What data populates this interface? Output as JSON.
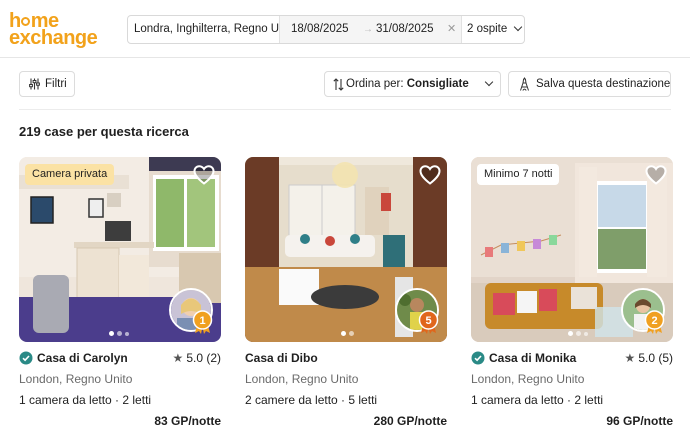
{
  "brand": {
    "line1": "h",
    "line1b": "me",
    "line2": "exchange"
  },
  "search": {
    "location": "Londra, Inghilterra, Regno Un",
    "date_start": "18/08/2025",
    "date_arrow": "→",
    "date_end": "31/08/2025",
    "clear_label": "✕",
    "guests": "2 ospite"
  },
  "toolbar": {
    "filters_label": "Filtri",
    "sort_prefix": "Ordina per:",
    "sort_value": "Consigliate",
    "save_label": "Salva questa destinazione"
  },
  "results": {
    "count_text": "219 case per questa ricerca"
  },
  "colors": {
    "brand": "#f2a21b",
    "verified": "#2a8a86",
    "level_badge": "#f0a020",
    "tag_yellow": "#fbe2a4"
  },
  "listings": [
    {
      "tag": "Camera privata",
      "verified": true,
      "title": "Casa di Carolyn",
      "rating": "5.0 (2)",
      "location": "London, Regno Unito",
      "rooms": "1 camera da letto · 2 letti",
      "price": "83 GP/notte",
      "level": "1",
      "photo_dots": 3,
      "active_dot": 0
    },
    {
      "tag": "",
      "verified": false,
      "title": "Casa di Dibo",
      "rating": "",
      "location": "London, Regno Unito",
      "rooms": "2 camere da letto · 5 letti",
      "price": "280 GP/notte",
      "level": "5",
      "photo_dots": 2,
      "active_dot": 0
    },
    {
      "tag": "Minimo 7 notti",
      "verified": true,
      "title": "Casa di Monika",
      "rating": "5.0 (5)",
      "location": "London, Regno Unito",
      "rooms": "1 camera da letto · 2 letti",
      "price": "96 GP/notte",
      "level": "2",
      "photo_dots": 3,
      "active_dot": 0
    }
  ]
}
